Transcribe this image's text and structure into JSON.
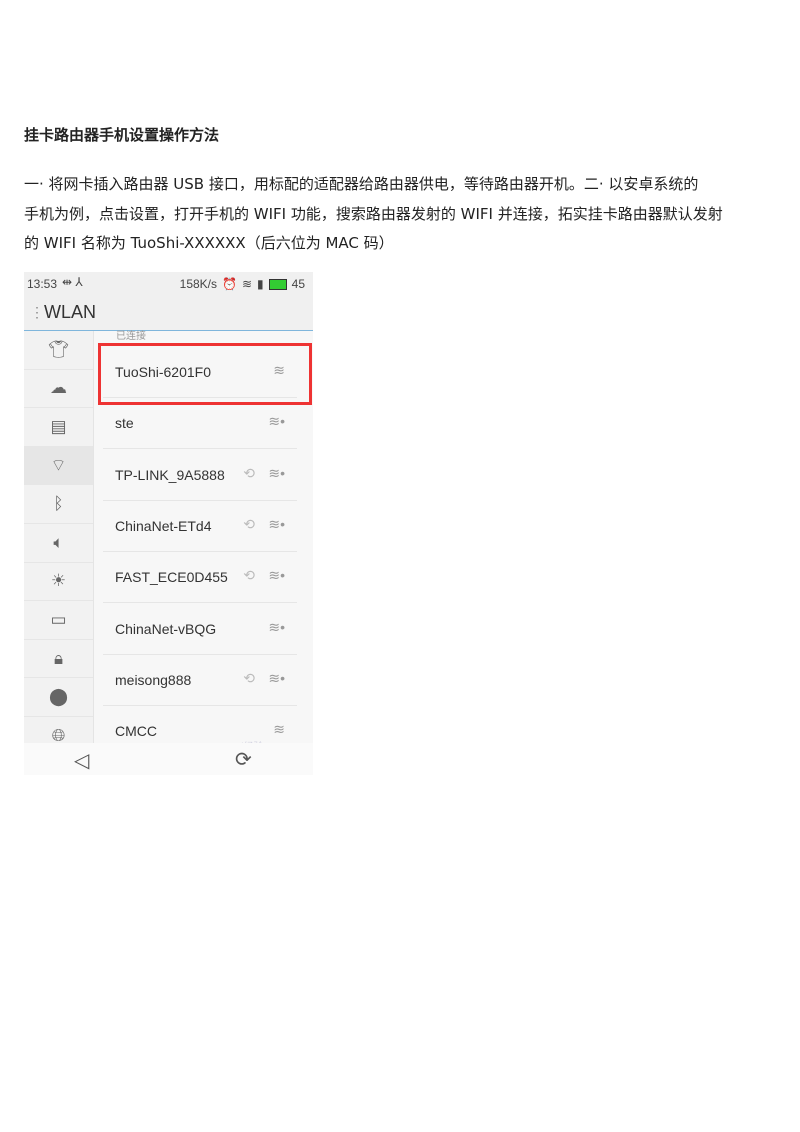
{
  "document": {
    "title": "挂卡路由器手机设置操作方法",
    "paragraph_lines": [
      "一· 将网卡插入路由器 USB 接口，用标配的适配器给路由器供电，等待路由器开机。二· 以安卓系统的",
      "手机为例，点击设置，打开手机的 WIFI 功能，搜索路由器发射的 WIFI 并连接，拓实挂卡路由器默认发射",
      "的 WIFI 名称为 TuoShi-XXXXXX（后六位为 MAC 码）"
    ]
  },
  "phone": {
    "status": {
      "time": "13:53",
      "speed": "158K/s",
      "battery": "45"
    },
    "header": {
      "title": "WLAN"
    },
    "section_label": "已连接",
    "sidebar": [
      "shirt-icon",
      "cloud-icon",
      "sim-icon",
      "wifi-icon",
      "bluetooth-icon",
      "volume-icon",
      "brightness-icon",
      "battery-icon",
      "lock-icon",
      "location-icon",
      "globe-icon"
    ],
    "sidebar_selected": "wifi-icon",
    "networks": [
      {
        "name": "TuoShi-6201F0",
        "connected": true,
        "secured": false,
        "syncing": false
      },
      {
        "name": "ste",
        "secured": true,
        "syncing": false
      },
      {
        "name": "TP-LINK_9A5888",
        "secured": true,
        "syncing": true
      },
      {
        "name": "ChinaNet-ETd4",
        "secured": true,
        "syncing": true
      },
      {
        "name": "FAST_ECE0D455",
        "secured": true,
        "syncing": true
      },
      {
        "name": "ChinaNet-vBQG",
        "secured": true,
        "syncing": false
      },
      {
        "name": "meisong888",
        "secured": true,
        "syncing": true
      },
      {
        "name": "CMCC",
        "secured": false,
        "syncing": false
      }
    ],
    "highlight_color": "#e33333"
  }
}
